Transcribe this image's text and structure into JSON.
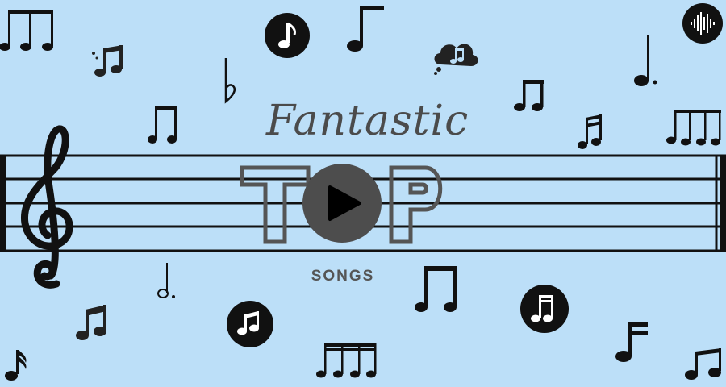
{
  "banner": {
    "title_script": "Fantastic",
    "title_big": "T",
    "title_big_end": "P",
    "subtitle": "SONGS"
  },
  "colors": {
    "background": "#bcdff8",
    "ink": "#111111",
    "title": "#4b4b4b",
    "play_button": "#4d4d4d"
  },
  "icons": [
    "treble-clef-icon",
    "play-icon",
    "music-note-icon",
    "flat-icon",
    "audio-wave-icon",
    "cloud-music-icon"
  ]
}
